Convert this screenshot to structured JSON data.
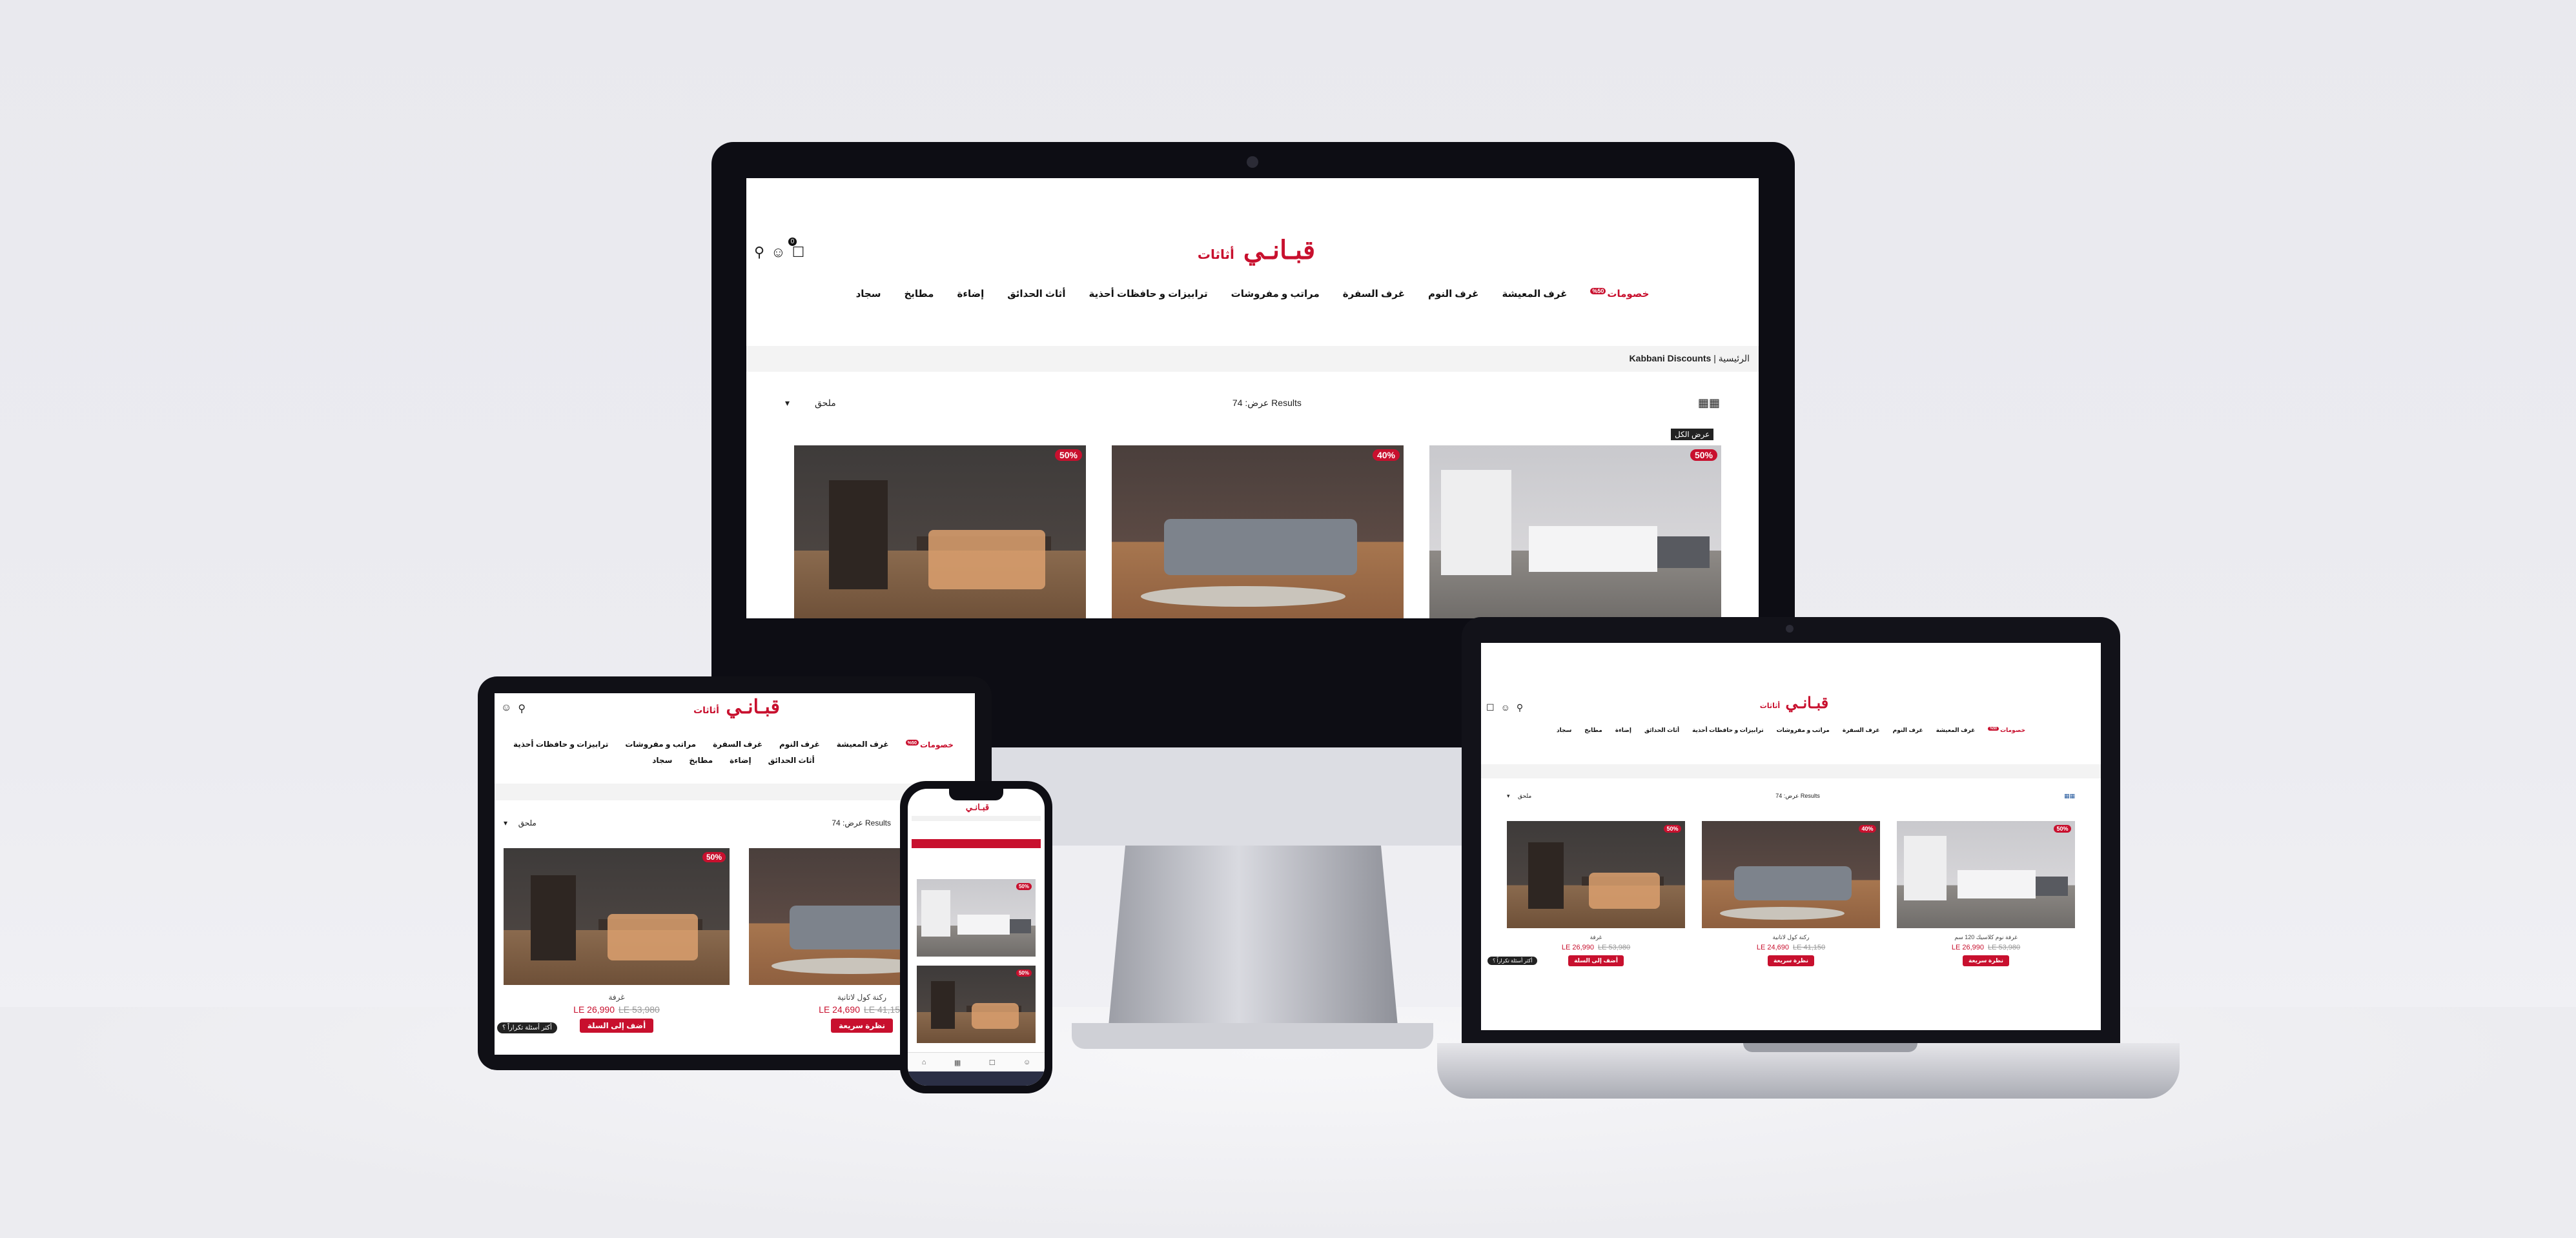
{
  "site": {
    "logo_text": "قبـانـي",
    "logo_sub": "أثاثات",
    "cart_count": "0",
    "nav": [
      {
        "label": "خصومات",
        "badge": "50%",
        "hot": true
      },
      {
        "label": "غرف المعيشة",
        "hot": false
      },
      {
        "label": "غرف النوم",
        "hot": false
      },
      {
        "label": "غرف السفرة",
        "hot": false
      },
      {
        "label": "مراتب و مفروشات",
        "hot": false
      },
      {
        "label": "ترابيزات و حافظات أحذية",
        "hot": false
      },
      {
        "label": "أثاث الحدائق",
        "hot": false
      },
      {
        "label": "إضاءة",
        "hot": false
      },
      {
        "label": "مطابخ",
        "hot": false
      },
      {
        "label": "سجاد",
        "hot": false
      }
    ],
    "breadcrumb_home": "الرئيسية",
    "breadcrumb_current": "Kabbani Discounts",
    "results_label": "عرض: 74 Results",
    "sort_value": "ملحق",
    "show_all": "عرض الكل",
    "chat_label": "أكثر أسئلة تكراراً ؟"
  },
  "products": [
    {
      "badge": "50%",
      "name": "غرفة نوم كلاسيك 120 سم",
      "price": "LE 26,990",
      "old_price": "LE 53,980",
      "button": "نظرة سريعة",
      "img": "bed"
    },
    {
      "badge": "40%",
      "name": "ركنة كول لاتانية",
      "price": "LE 24,690",
      "old_price": "LE 41,150",
      "button": "نظرة سريعة",
      "img": "sofa"
    },
    {
      "badge": "50%",
      "name": "غرفة",
      "price": "LE 26,990",
      "old_price": "LE 53,980",
      "button": "أضف إلى السلة",
      "img": "dining"
    }
  ],
  "colors": {
    "brand": "#c8102e",
    "frame": "#0d0d14"
  }
}
